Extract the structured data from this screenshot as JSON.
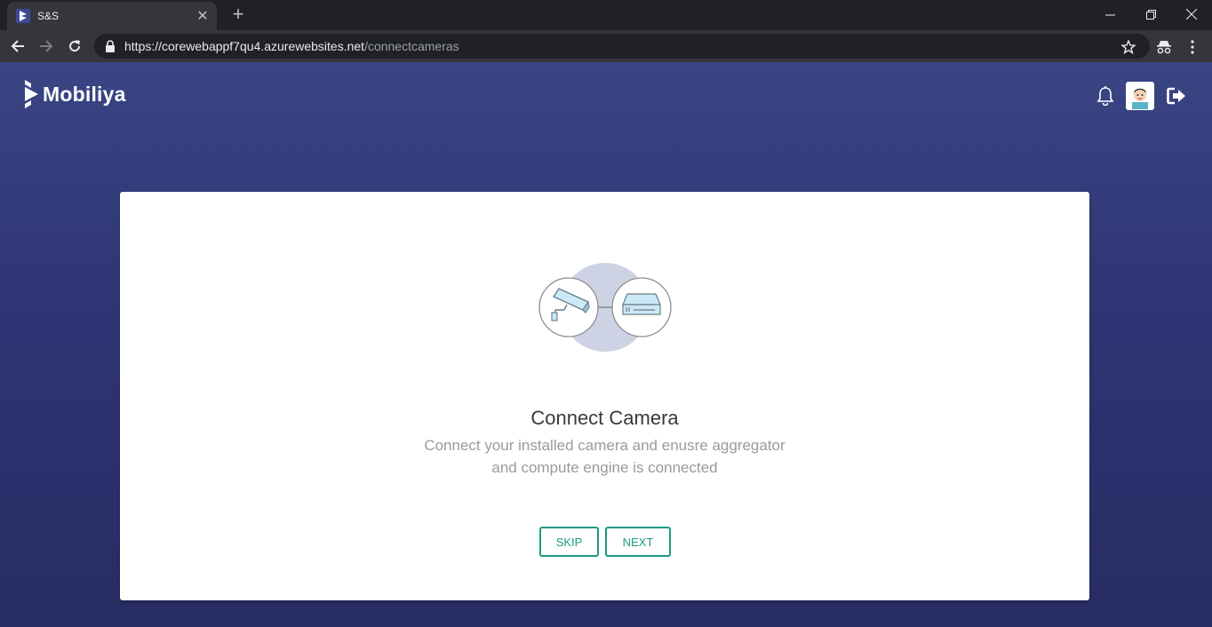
{
  "browser": {
    "tab_title": "S&S",
    "url_host": "https://corewebappf7qu4.azurewebsites.net",
    "url_path": "/connectcameras"
  },
  "header": {
    "logo_text": "Mobiliya"
  },
  "card": {
    "title": "Connect Camera",
    "description_line1": "Connect your installed camera and enusre aggregator",
    "description_line2": "and compute engine is connected",
    "skip_label": "SKIP",
    "next_label": "NEXT"
  },
  "colors": {
    "accent": "#1d9a82",
    "background": "#2f3676"
  }
}
